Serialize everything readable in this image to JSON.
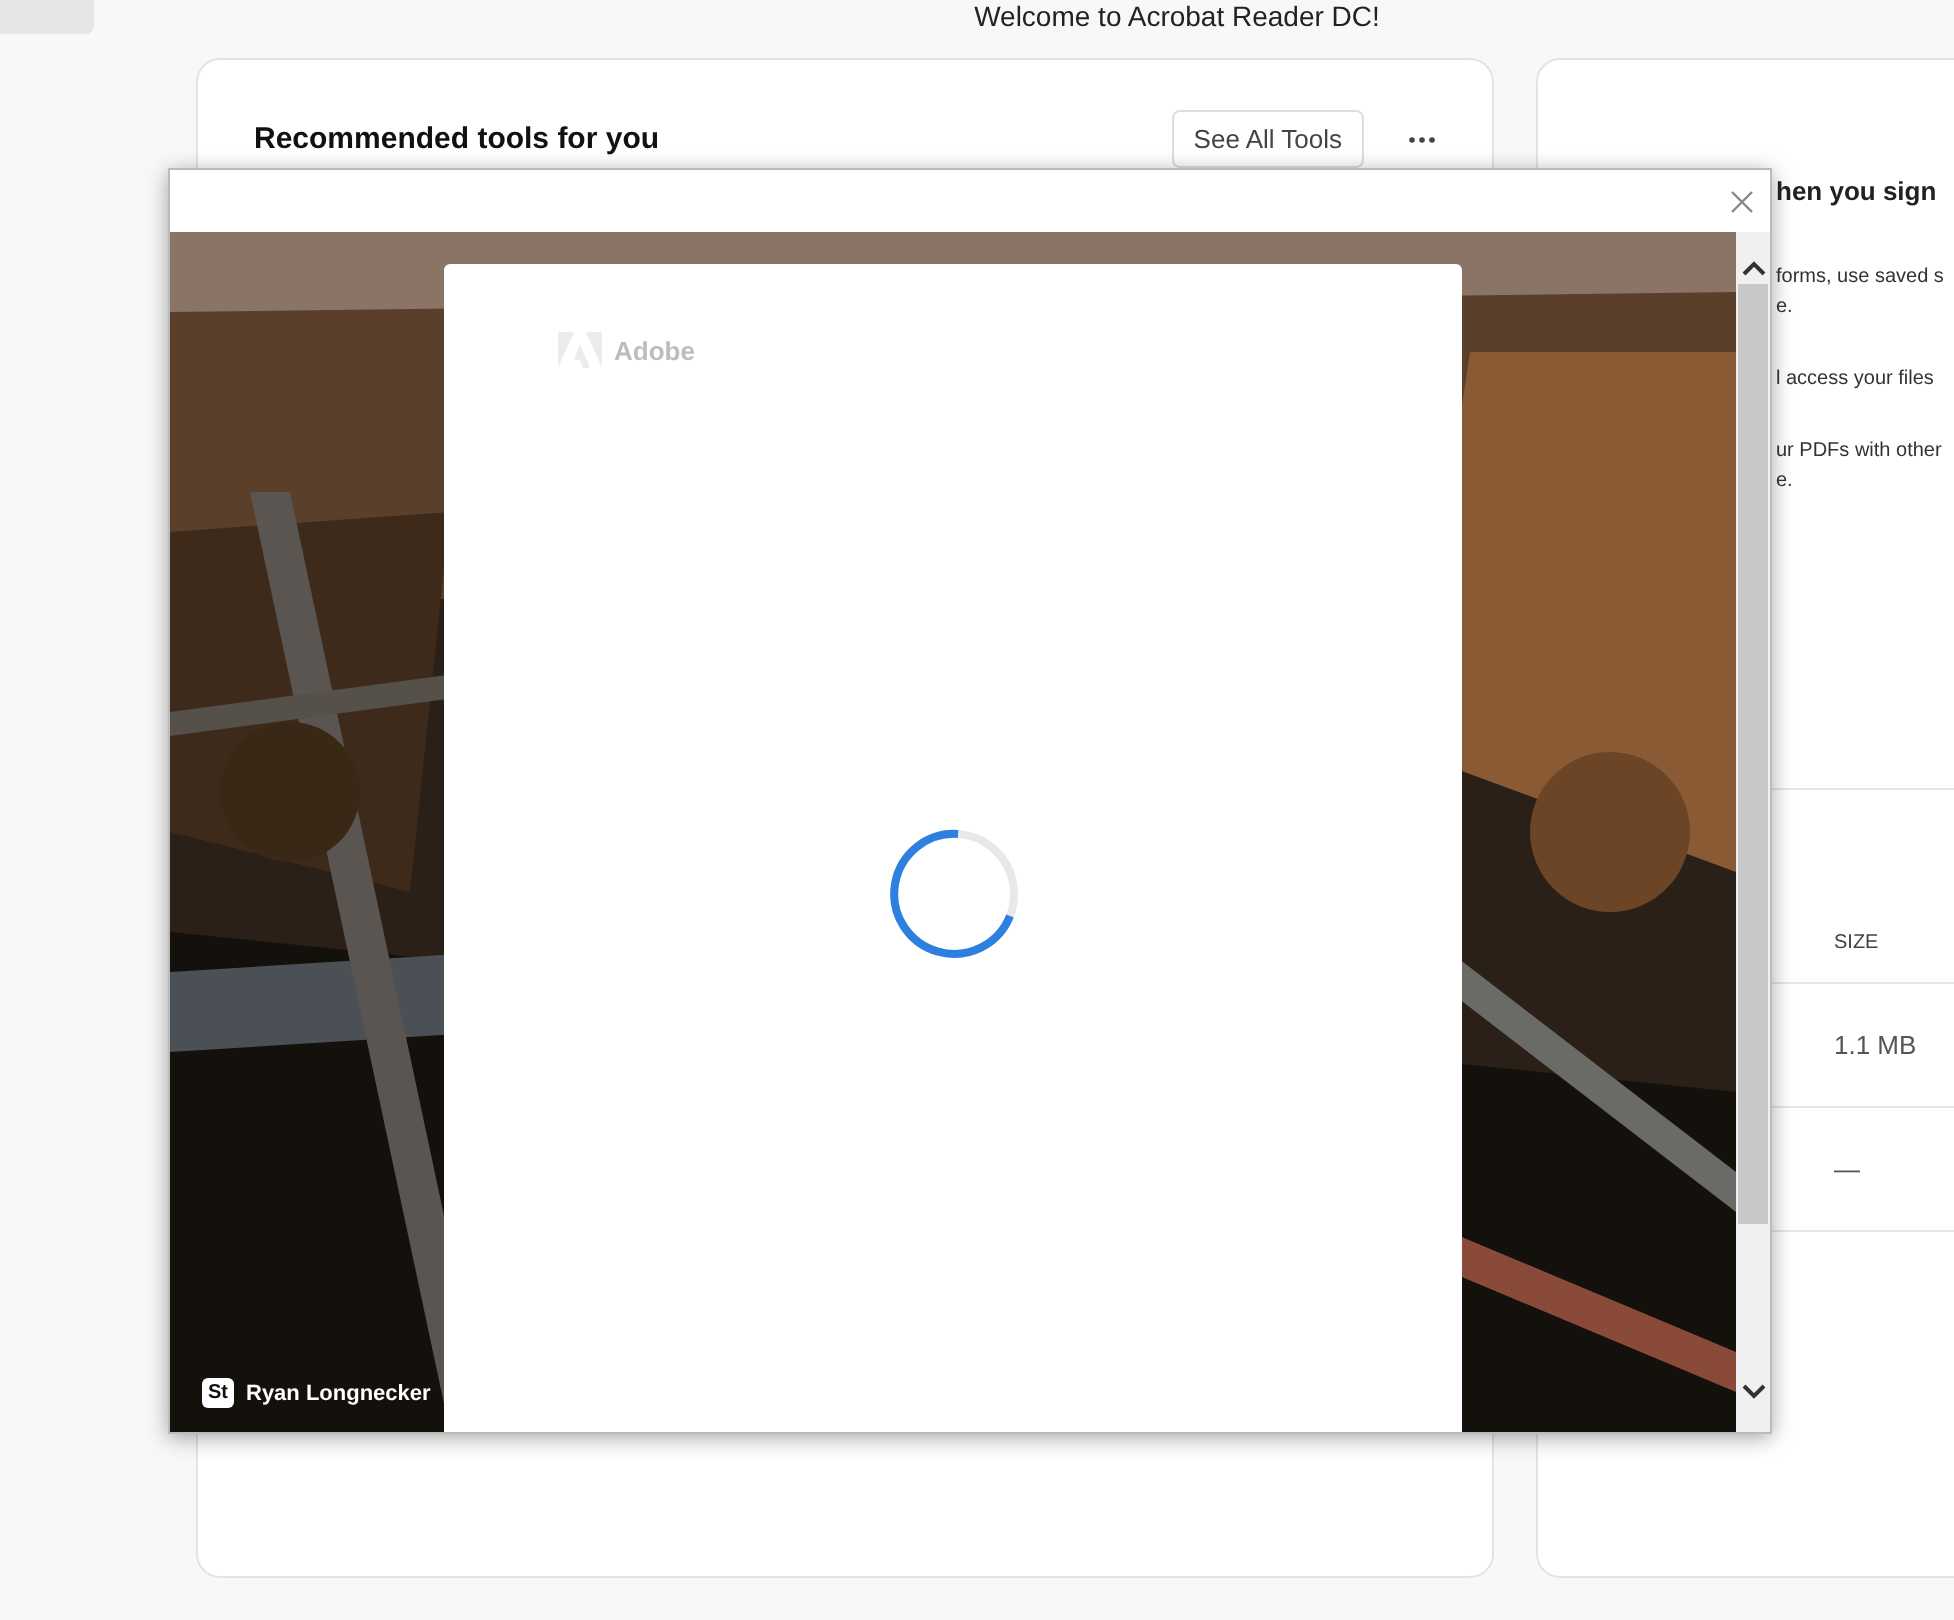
{
  "welcome": "Welcome to Acrobat Reader DC!",
  "tools_card": {
    "title": "Recommended tools for you",
    "button": "See All Tools"
  },
  "signin_card": {
    "heading": "hen you sign",
    "paragraphs": [
      [
        "forms, use saved s",
        "e."
      ],
      [
        "l access your files"
      ],
      [
        "ur PDFs with other",
        "e."
      ]
    ]
  },
  "files_table": {
    "column": "SIZE",
    "rows": [
      "1.1 MB",
      "—"
    ]
  },
  "dialog": {
    "brand": "Adobe",
    "badge": "St",
    "credit": "Ryan Longnecker"
  }
}
